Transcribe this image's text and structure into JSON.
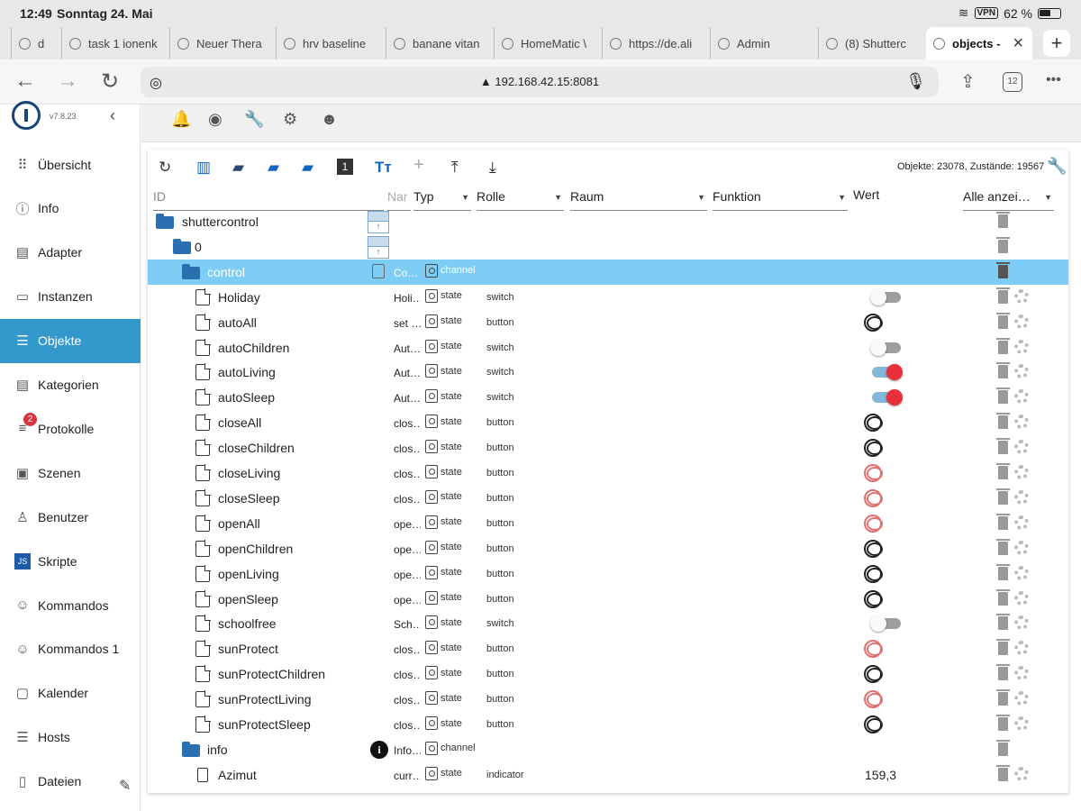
{
  "statusbar": {
    "time": "12:49",
    "date": "Sonntag 24. Mai",
    "vpn": "VPN",
    "battery": "62 %",
    "battery_level": 0.62
  },
  "tabs": [
    {
      "label": "d",
      "active": false
    },
    {
      "label": "task 1 ionenk",
      "active": false
    },
    {
      "label": "Neuer Thera",
      "active": false
    },
    {
      "label": "hrv baseline",
      "active": false
    },
    {
      "label": "banane vitan",
      "active": false
    },
    {
      "label": "HomeMatic \\",
      "active": false
    },
    {
      "label": "https://de.ali",
      "active": false
    },
    {
      "label": "Admin",
      "active": false
    },
    {
      "label": "(8) Shutterc",
      "active": false
    },
    {
      "label": "objects -",
      "active": true
    }
  ],
  "browser": {
    "url": "▲ 192.168.42.15:8081",
    "tab_count": "12"
  },
  "app": {
    "version": "v7.8.23"
  },
  "sidebar": {
    "items": [
      {
        "label": "Übersicht",
        "icon": "grid-icon"
      },
      {
        "label": "Info",
        "icon": "info-icon"
      },
      {
        "label": "Adapter",
        "icon": "store-icon"
      },
      {
        "label": "Instanzen",
        "icon": "keyboard-icon"
      },
      {
        "label": "Objekte",
        "icon": "list-icon",
        "active": true
      },
      {
        "label": "Kategorien",
        "icon": "categories-icon"
      },
      {
        "label": "Protokolle",
        "icon": "log-icon",
        "badge": "2"
      },
      {
        "label": "Szenen",
        "icon": "scenes-icon"
      },
      {
        "label": "Benutzer",
        "icon": "user-icon"
      },
      {
        "label": "Skripte",
        "icon": "js-icon"
      },
      {
        "label": "Kommandos",
        "icon": "commands-icon"
      },
      {
        "label": "Kommandos 1",
        "icon": "commands-icon"
      },
      {
        "label": "Kalender",
        "icon": "calendar-icon"
      },
      {
        "label": "Hosts",
        "icon": "hosts-icon"
      },
      {
        "label": "Dateien",
        "icon": "files-icon"
      }
    ]
  },
  "objects": {
    "counter": "Objekte: 23078, Zustände: 19567",
    "headers": {
      "id": "ID",
      "name": "Nar",
      "type": "Typ",
      "role": "Rolle",
      "room": "Raum",
      "function": "Funktion",
      "value": "Wert",
      "show_all": "Alle anzei…"
    },
    "rows": [
      {
        "id": "shuttercontrol",
        "kind": "folder",
        "indent": 0,
        "name": "",
        "type": "",
        "role": "",
        "value_kind": "none"
      },
      {
        "id": "0",
        "kind": "folder",
        "indent": 1,
        "name": "",
        "type": "",
        "role": "",
        "value_kind": "none"
      },
      {
        "id": "control",
        "kind": "folder",
        "indent": 2,
        "name": "Co…",
        "type": "channel",
        "role": "",
        "value_kind": "none",
        "selected": true
      },
      {
        "id": "Holiday",
        "kind": "file",
        "indent": 3,
        "name": "Holi…",
        "type": "state",
        "role": "switch",
        "value_kind": "toggle",
        "on": false
      },
      {
        "id": "autoAll",
        "kind": "file",
        "indent": 3,
        "name": "set …",
        "type": "state",
        "role": "button",
        "value_kind": "button",
        "red": false
      },
      {
        "id": "autoChildren",
        "kind": "file",
        "indent": 3,
        "name": "Aut…",
        "type": "state",
        "role": "switch",
        "value_kind": "toggle",
        "on": false
      },
      {
        "id": "autoLiving",
        "kind": "file",
        "indent": 3,
        "name": "Aut…",
        "type": "state",
        "role": "switch",
        "value_kind": "toggle",
        "on": true
      },
      {
        "id": "autoSleep",
        "kind": "file",
        "indent": 3,
        "name": "Aut…",
        "type": "state",
        "role": "switch",
        "value_kind": "toggle",
        "on": true
      },
      {
        "id": "closeAll",
        "kind": "file",
        "indent": 3,
        "name": "clos…",
        "type": "state",
        "role": "button",
        "value_kind": "button",
        "red": false
      },
      {
        "id": "closeChildren",
        "kind": "file",
        "indent": 3,
        "name": "clos…",
        "type": "state",
        "role": "button",
        "value_kind": "button",
        "red": false
      },
      {
        "id": "closeLiving",
        "kind": "file",
        "indent": 3,
        "name": "clos…",
        "type": "state",
        "role": "button",
        "value_kind": "button",
        "red": true
      },
      {
        "id": "closeSleep",
        "kind": "file",
        "indent": 3,
        "name": "clos…",
        "type": "state",
        "role": "button",
        "value_kind": "button",
        "red": true
      },
      {
        "id": "openAll",
        "kind": "file",
        "indent": 3,
        "name": "ope…",
        "type": "state",
        "role": "button",
        "value_kind": "button",
        "red": true
      },
      {
        "id": "openChildren",
        "kind": "file",
        "indent": 3,
        "name": "ope…",
        "type": "state",
        "role": "button",
        "value_kind": "button",
        "red": false
      },
      {
        "id": "openLiving",
        "kind": "file",
        "indent": 3,
        "name": "ope…",
        "type": "state",
        "role": "button",
        "value_kind": "button",
        "red": false
      },
      {
        "id": "openSleep",
        "kind": "file",
        "indent": 3,
        "name": "ope…",
        "type": "state",
        "role": "button",
        "value_kind": "button",
        "red": false
      },
      {
        "id": "schoolfree",
        "kind": "file",
        "indent": 3,
        "name": "Sch…",
        "type": "state",
        "role": "switch",
        "value_kind": "toggle",
        "on": false
      },
      {
        "id": "sunProtect",
        "kind": "file",
        "indent": 3,
        "name": "clos…",
        "type": "state",
        "role": "button",
        "value_kind": "button",
        "red": true
      },
      {
        "id": "sunProtectChildren",
        "kind": "file",
        "indent": 3,
        "name": "clos…",
        "type": "state",
        "role": "button",
        "value_kind": "button",
        "red": false
      },
      {
        "id": "sunProtectLiving",
        "kind": "file",
        "indent": 3,
        "name": "clos…",
        "type": "state",
        "role": "button",
        "value_kind": "button",
        "red": true
      },
      {
        "id": "sunProtectSleep",
        "kind": "file",
        "indent": 3,
        "name": "clos…",
        "type": "state",
        "role": "button",
        "value_kind": "button",
        "red": false
      },
      {
        "id": "info",
        "kind": "folder",
        "indent": 2,
        "name": "Info…",
        "type": "channel",
        "role": "",
        "value_kind": "none"
      },
      {
        "id": "Azimut",
        "kind": "lockfile",
        "indent": 3,
        "name": "curr…",
        "type": "state",
        "role": "indicator",
        "value_kind": "text",
        "value": "159,3"
      }
    ]
  }
}
